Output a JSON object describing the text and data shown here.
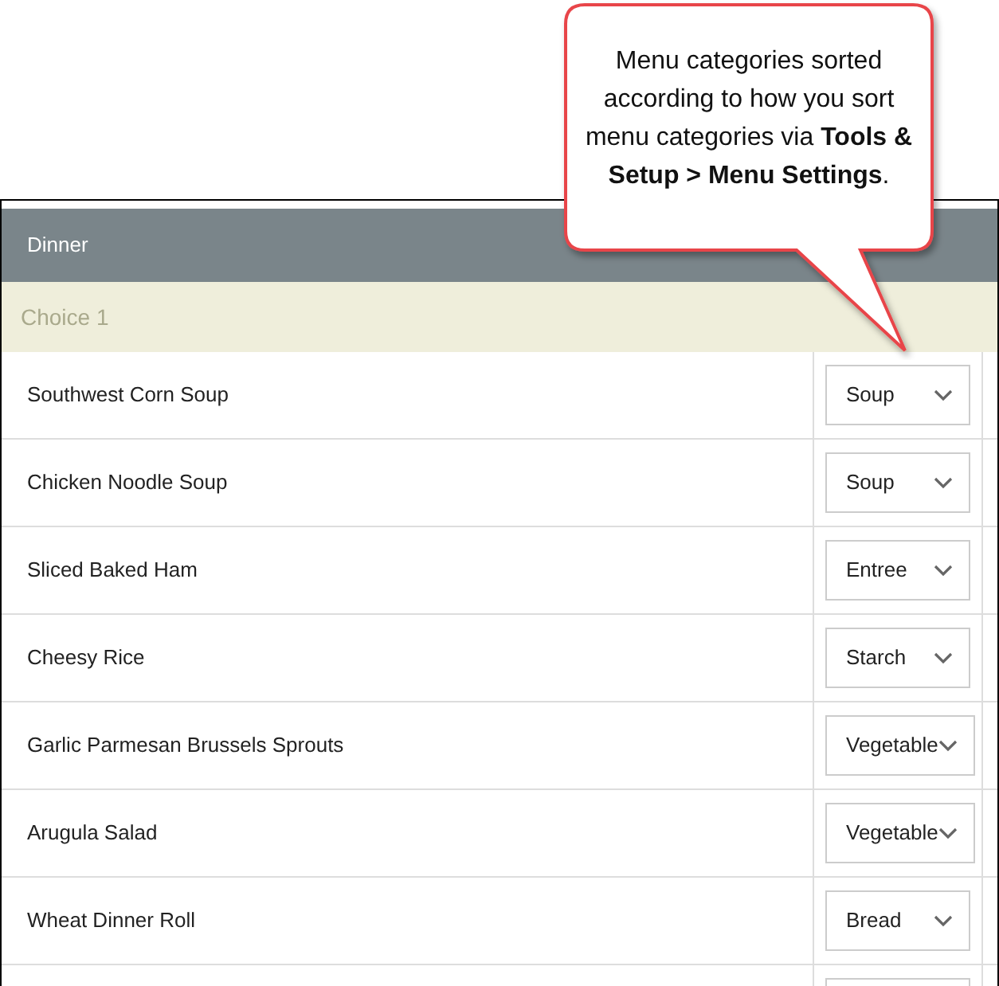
{
  "callout": {
    "text": "Menu categories sorted according to how you sort menu categories via **Tools & Setup > Menu Settings**."
  },
  "table": {
    "meal": "Dinner",
    "group": "Choice 1",
    "rows": [
      {
        "item": "Southwest Corn Soup",
        "category": "Soup"
      },
      {
        "item": "Chicken Noodle Soup",
        "category": "Soup"
      },
      {
        "item": "Sliced Baked Ham",
        "category": "Entree"
      },
      {
        "item": "Cheesy Rice",
        "category": "Starch"
      },
      {
        "item": "Garlic Parmesan Brussels Sprouts",
        "category": "Vegetable"
      },
      {
        "item": "Arugula Salad",
        "category": "Vegetable"
      },
      {
        "item": "Wheat Dinner Roll",
        "category": "Bread"
      }
    ]
  }
}
